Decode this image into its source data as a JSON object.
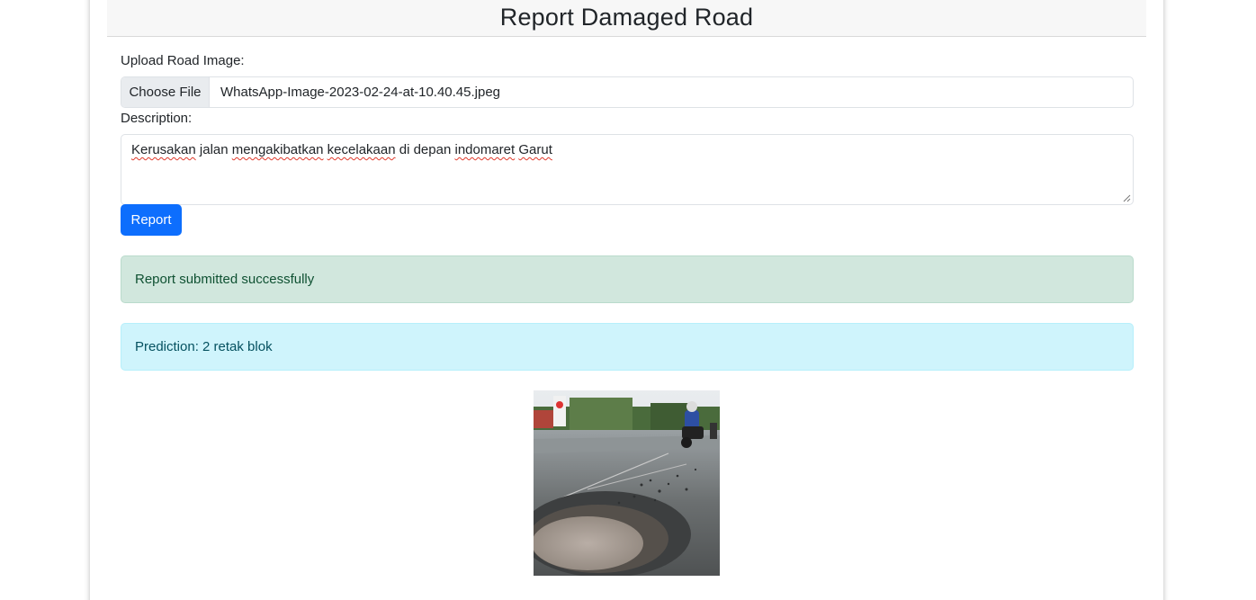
{
  "page": {
    "title": "Report Damaged Road"
  },
  "form": {
    "image_label": "Upload Road Image:",
    "choose_file_label": "Choose File",
    "file_name": "WhatsApp-Image-2023-02-24-at-10.40.45.jpeg",
    "description_label": "Description:",
    "description_words": [
      "Kerusakan",
      "jalan",
      "mengakibatkan",
      "kecelakaan",
      "di",
      "depan",
      "indomaret",
      "Garut"
    ],
    "report_label": "Report"
  },
  "alerts": {
    "success": "Report submitted successfully",
    "prediction": "Prediction: 2 retak blok"
  },
  "colors": {
    "primary": "#0d6efd",
    "success_bg": "#d1e7dd",
    "success_text": "#0f5132",
    "info_bg": "#cff4fc",
    "info_text": "#055160",
    "spellcheck": "#e0392b"
  },
  "icons": {
    "resize": "resize-handle-icon"
  }
}
